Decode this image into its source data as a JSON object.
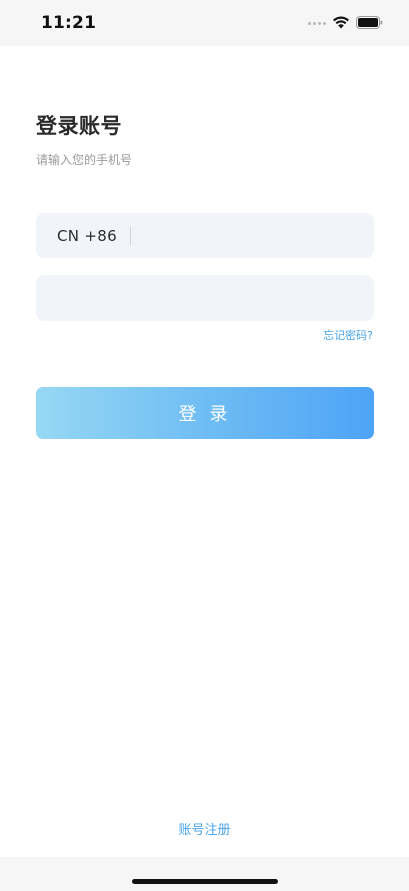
{
  "status_bar": {
    "time": "11:21"
  },
  "login": {
    "title": "登录账号",
    "subtitle": "请输入您的手机号",
    "country_code": "CN +86",
    "phone_value": "",
    "password_value": "",
    "forgot_password": "忘记密码?",
    "login_button": "登 录",
    "register_link": "账号注册"
  },
  "colors": {
    "accent": "#4aa4ea",
    "button_gradient_start": "#97d8f3",
    "button_gradient_end": "#4ea3f6",
    "field_background": "#f1f5fa"
  }
}
